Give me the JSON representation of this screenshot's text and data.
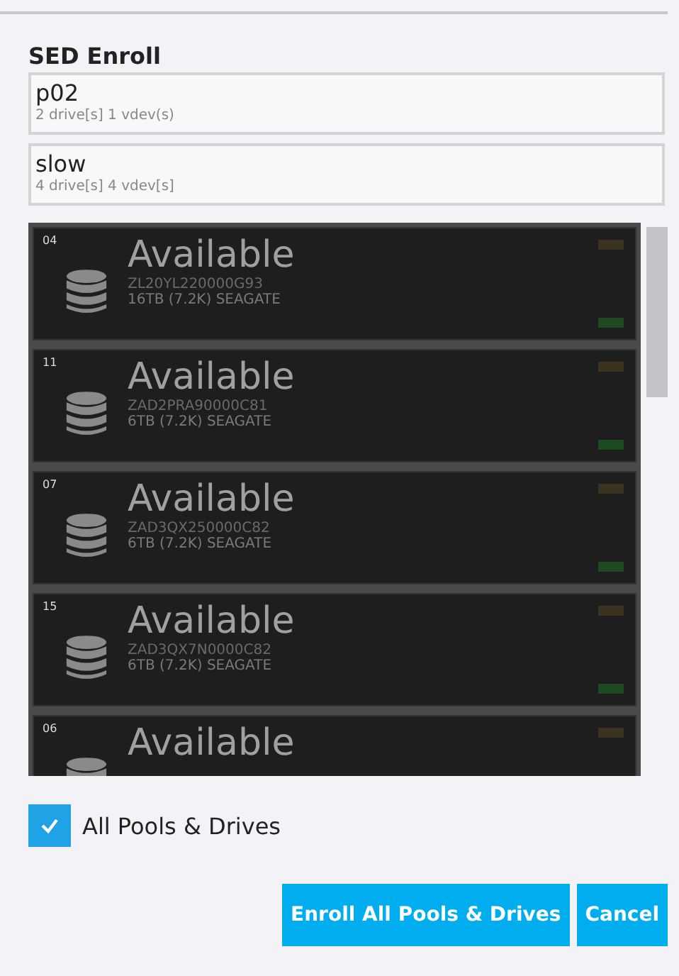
{
  "title": "SED Enroll",
  "pools": [
    {
      "name": "p02",
      "detail": "2 drive[s] 1 vdev(s)"
    },
    {
      "name": "slow",
      "detail": "4 drive[s] 4 vdev[s]"
    }
  ],
  "drives": [
    {
      "slot": "04",
      "status": "Available",
      "serial": "ZL20YL220000G93",
      "model": "16TB (7.2K) SEAGATE"
    },
    {
      "slot": "11",
      "status": "Available",
      "serial": "ZAD2PRA90000C81",
      "model": "6TB (7.2K) SEAGATE"
    },
    {
      "slot": "07",
      "status": "Available",
      "serial": "ZAD3QX250000C82",
      "model": "6TB (7.2K) SEAGATE"
    },
    {
      "slot": "15",
      "status": "Available",
      "serial": "ZAD3QX7N0000C82",
      "model": "6TB (7.2K) SEAGATE"
    },
    {
      "slot": "06",
      "status": "Available"
    }
  ],
  "all_option": {
    "label": "All Pools & Drives",
    "checked": true
  },
  "buttons": [
    "Enroll All Pools & Drives",
    "Cancel"
  ]
}
